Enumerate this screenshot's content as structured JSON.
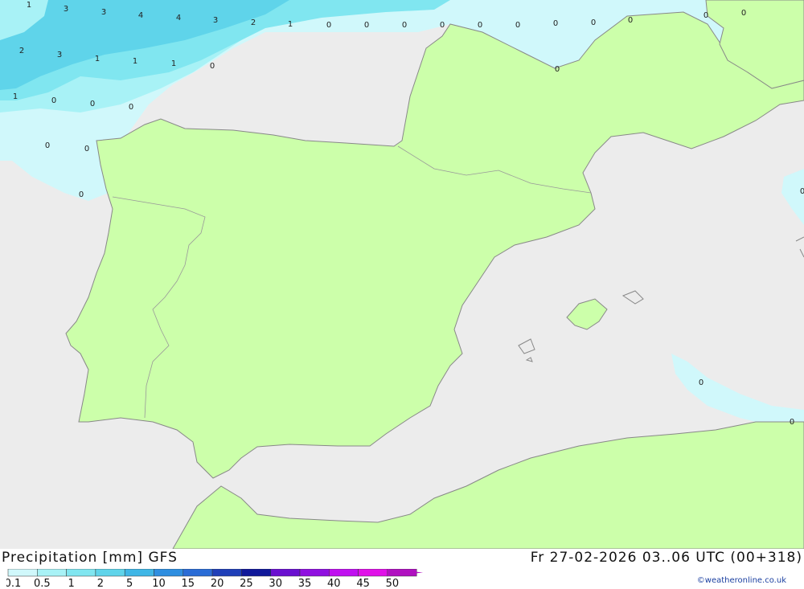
{
  "map": {
    "title": "Precipitation [mm] GFS",
    "datetime": "Fr 27-02-2026 03..06 UTC (00+318)",
    "credit": "©weatheronline.co.uk",
    "colors": {
      "sea": "#ececec",
      "land": "#ccffaa",
      "coast": "#888888"
    },
    "legend": {
      "ticks": [
        "0.1",
        "0.5",
        "1",
        "2",
        "5",
        "10",
        "15",
        "20",
        "25",
        "30",
        "35",
        "40",
        "45",
        "50"
      ],
      "colors": [
        "#d0f8fb",
        "#a8f2f6",
        "#80e6f0",
        "#5fd4ea",
        "#3fb6e6",
        "#2e8ee0",
        "#2a6cd6",
        "#1f3fb8",
        "#10189a",
        "#6a10d0",
        "#9010e0",
        "#c010f0",
        "#e010e8",
        "#b010c0"
      ]
    },
    "values": [
      "1",
      "3",
      "3",
      "4",
      "4",
      "3",
      "2",
      "1",
      "0",
      "0",
      "0",
      "0",
      "0",
      "0",
      "0",
      "0",
      "0",
      "0",
      "0",
      "2",
      "3",
      "1",
      "1",
      "1",
      "0",
      "0",
      "1",
      "0",
      "0",
      "0",
      "0",
      "0",
      "0",
      "0",
      "0",
      "0"
    ]
  }
}
